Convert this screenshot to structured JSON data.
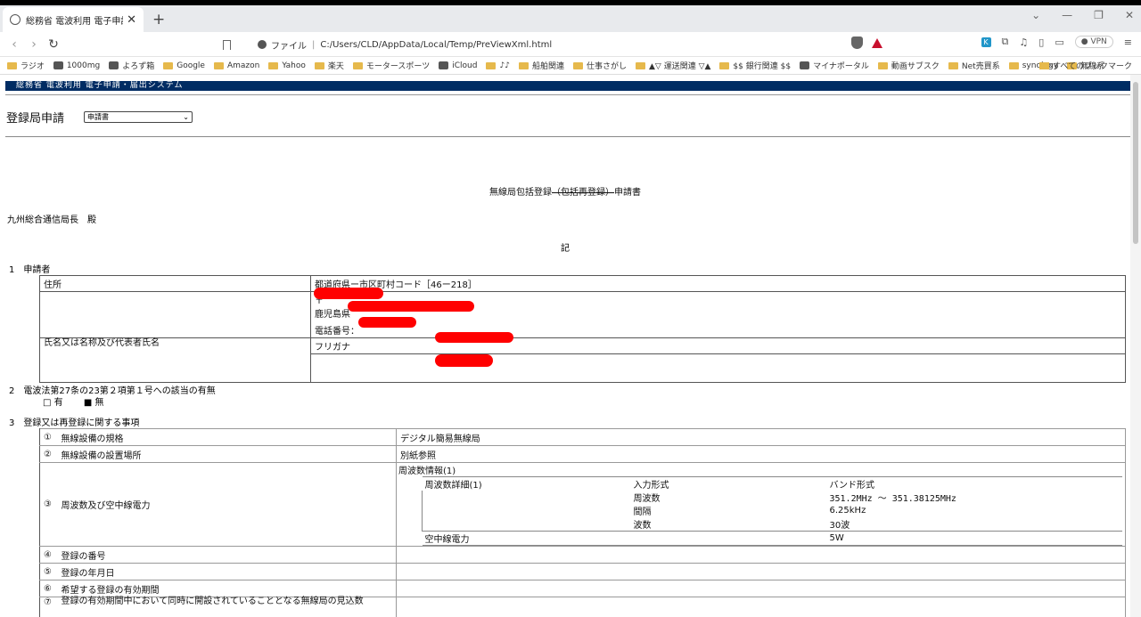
{
  "browser": {
    "tab_title": "総務省 電波利用 電子申請･届出",
    "url_scheme": "ファイル",
    "url": "C:/Users/CLD/AppData/Local/Temp/PreViewXml.html",
    "vpn": "VPN",
    "bookmarks": [
      "ラジオ",
      "1000mg",
      "よろず箱",
      "Google",
      "Amazon",
      "Yahoo",
      "楽天",
      "モータースポーツ",
      "iCloud",
      "♪♪",
      "船舶関連",
      "仕事さがし",
      "▲▽ 運送関連 ▽▲",
      "$$ 銀行関連 $$",
      "マイナポータル",
      "動画サブスク",
      "Net売買系",
      "synology",
      "無線系"
    ],
    "bookmarks_all": "すべてのブックマーク"
  },
  "system": {
    "banner": "総務省 電波利用 電子申請・届出システム",
    "app_title": "登録局申請",
    "select_value": "申請書"
  },
  "doc": {
    "title_plain": "無線局包括登録",
    "title_struck": "（包括再登録）",
    "title_suffix": "申請書",
    "addressee": "九州総合通信局長　殿",
    "ki": "記",
    "s1": "1　申請者",
    "addr_label": "住所",
    "addr_line1": "都道府県ー市区町村コード［46ー218］",
    "addr_line2": "〒",
    "addr_line3": "鹿児島県",
    "phone": "電話番号：",
    "name_label": "氏名又は名称及び代表者氏名",
    "furigana": "フリガナ",
    "s2": "2　電波法第27条の23第２項第１号への該当の有無",
    "opt_yes": "□ 有",
    "opt_no": "■ 無",
    "s3": "3　登録又は再登録に関する事項",
    "rows": [
      {
        "num": "①",
        "label": "無線設備の規格",
        "value": "デジタル簡易無線局"
      },
      {
        "num": "②",
        "label": "無線設備の設置場所",
        "value": "別紙参照"
      },
      {
        "num": "③",
        "label": "周波数及び空中線電力",
        "value": ""
      },
      {
        "num": "④",
        "label": "登録の番号",
        "value": ""
      },
      {
        "num": "⑤",
        "label": "登録の年月日",
        "value": ""
      },
      {
        "num": "⑥",
        "label": "希望する登録の有効期間",
        "value": ""
      },
      {
        "num": "⑦",
        "label": "登録の有効期間中において同時に開設されていることとなる無線局の見込数",
        "value": ""
      }
    ],
    "freq": {
      "info": "周波数情報(1)",
      "detail": "周波数詳細(1)",
      "input_type_label": "入力形式",
      "input_type": "バンド形式",
      "freq_label": "周波数",
      "freq_value": "351.2MHz 〜 351.38125MHz",
      "interval_label": "間隔",
      "interval": "6.25kHz",
      "waves_label": "波数",
      "waves": "30波",
      "power_label": "空中線電力",
      "power": "5W"
    }
  }
}
